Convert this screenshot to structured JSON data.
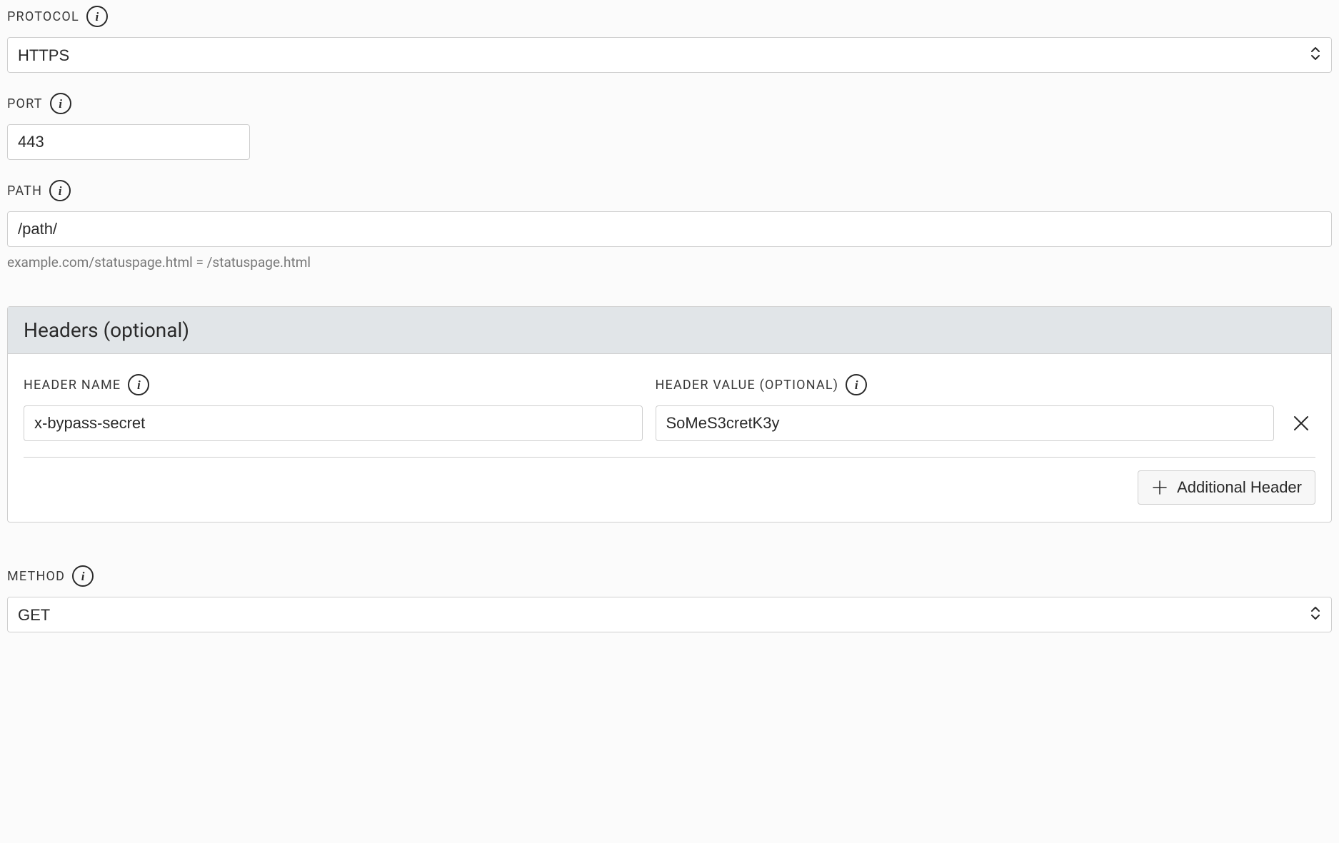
{
  "protocol": {
    "label": "PROTOCOL",
    "value": "HTTPS"
  },
  "port": {
    "label": "PORT",
    "value": "443"
  },
  "path": {
    "label": "PATH",
    "value": "/path/",
    "hint": "example.com/statuspage.html = /statuspage.html"
  },
  "headers_section": {
    "title": "Headers (optional)",
    "name_label": "HEADER NAME",
    "value_label": "HEADER VALUE (OPTIONAL)",
    "row": {
      "name": "x-bypass-secret",
      "value": "SoMeS3cretK3y"
    },
    "add_button": "Additional Header"
  },
  "method": {
    "label": "METHOD",
    "value": "GET"
  }
}
